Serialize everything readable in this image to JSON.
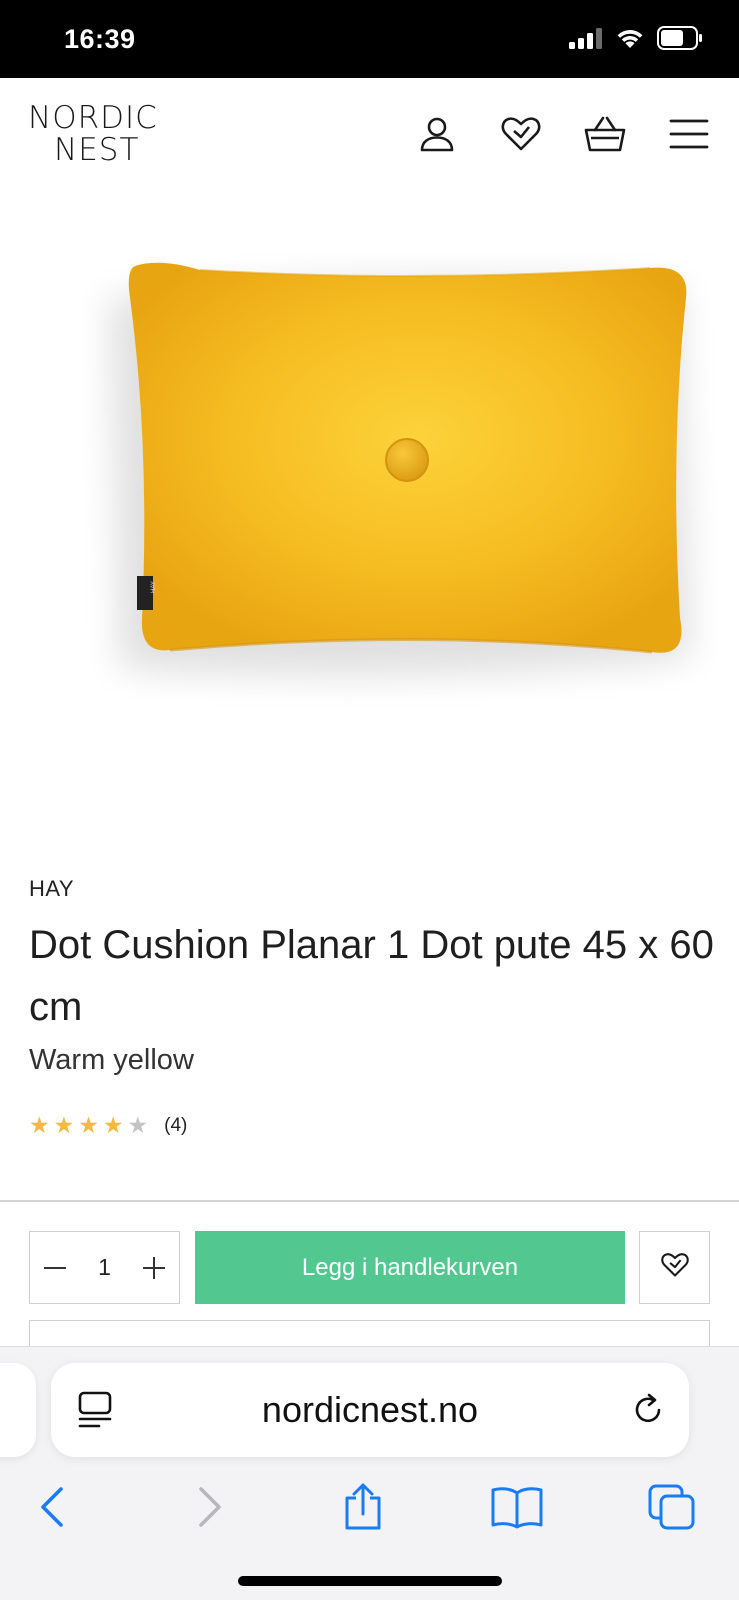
{
  "status_bar": {
    "time": "16:39"
  },
  "header": {
    "logo_line1": "NORDIC",
    "logo_line2": "NEST",
    "icons": [
      "user-icon",
      "heart-icon",
      "basket-icon",
      "menu-icon"
    ]
  },
  "product": {
    "brand": "HAY",
    "title": "Dot Cushion Planar 1 Dot pute 45 x 60 cm",
    "variant": "Warm yellow",
    "rating": 4,
    "rating_max": 5,
    "review_count": "(4)",
    "image_tag": "HAY"
  },
  "buy": {
    "quantity": "1",
    "decrement": "−",
    "increment": "+",
    "add_to_cart_label": "Legg i handlekurven"
  },
  "safari": {
    "url": "nordicnest.no"
  },
  "colors": {
    "accent_green": "#52c890",
    "star_on": "#f5b942",
    "star_off": "#c4c4c4",
    "cushion_yellow": "#f3b81c",
    "ios_blue": "#1a7cf5"
  }
}
